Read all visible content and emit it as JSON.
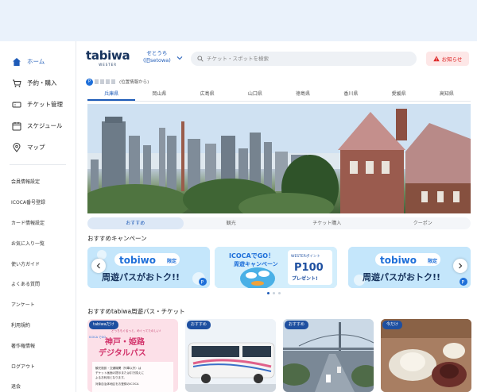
{
  "sidebar": {
    "main": [
      {
        "label": "ホーム",
        "icon": "home-icon",
        "active": true
      },
      {
        "label": "予約・購入",
        "icon": "cart-icon"
      },
      {
        "label": "チケット管理",
        "icon": "ticket-icon"
      },
      {
        "label": "スケジュール",
        "icon": "calendar-icon"
      },
      {
        "label": "マップ",
        "icon": "map-pin-icon"
      }
    ],
    "sub": [
      {
        "label": "会員情報設定"
      },
      {
        "label": "ICOCA番号登録"
      },
      {
        "label": "カード情報設定"
      },
      {
        "label": "お気に入り一覧"
      },
      {
        "label": "使い方ガイド"
      },
      {
        "label": "よくある質問"
      },
      {
        "label": "アンケート"
      },
      {
        "label": "利用規約"
      },
      {
        "label": "著作権情報"
      },
      {
        "label": "ログアウト"
      },
      {
        "label": "退会"
      }
    ]
  },
  "header": {
    "logo_text": "tabiwa",
    "logo_sub": "WESTER",
    "region_name": "せとうち",
    "region_sub": "(旧setowa)",
    "search_placeholder": "チケット・スポットを検索",
    "notice_label": "お知らせ"
  },
  "location": {
    "badge": "P",
    "text": "(位置情報から)"
  },
  "prefecture_tabs": [
    {
      "label": "兵庫県",
      "active": true
    },
    {
      "label": "岡山県"
    },
    {
      "label": "広島県"
    },
    {
      "label": "山口県"
    },
    {
      "label": "徳島県"
    },
    {
      "label": "香川県"
    },
    {
      "label": "愛媛県"
    },
    {
      "label": "高知県"
    }
  ],
  "content_tabs": [
    {
      "label": "おすすめ",
      "active": true
    },
    {
      "label": "観光"
    },
    {
      "label": "チケット購入"
    },
    {
      "label": "クーポン"
    }
  ],
  "campaign": {
    "title": "おすすめキャンペーン",
    "banners": [
      {
        "brand": "tobiwo",
        "tag": "限定",
        "headline": "周遊パスがおトク!!",
        "badge": "P"
      },
      {
        "title1": "ICOCAでGO！",
        "title2": "周遊キャンペーン",
        "point_label": "WESTERポイント",
        "points": "P100",
        "present": "プレゼント!"
      },
      {
        "brand": "tobiwo",
        "tag": "限定",
        "headline": "周遊パスがおトク!!",
        "badge": "P"
      }
    ]
  },
  "passes": {
    "title": "おすすめtabiwa周遊パス・チケット",
    "cards": [
      {
        "badge": "tabiwaだけ",
        "tagline": "どっちもぐるっと、めぐってたのしい!",
        "title1": "神戸・姫路",
        "title2": "デジタルパス",
        "note1": "観光施設・交通機関（列車以外）は",
        "note2": "チケット画面の提示または引き換えに",
        "note3": "よるお利用となります。",
        "note4": "対象自治体地区をお登録のICOCA",
        "side": "ICOCA でGO"
      },
      {
        "badge": "おすすめ"
      },
      {
        "badge": "おすすめ"
      },
      {
        "badge": "今だけ"
      }
    ]
  },
  "colors": {
    "accent": "#1e5bb8",
    "brand_navy": "#16325c",
    "notice_red": "#d22222",
    "banner_blue": "#bfe3fb"
  }
}
